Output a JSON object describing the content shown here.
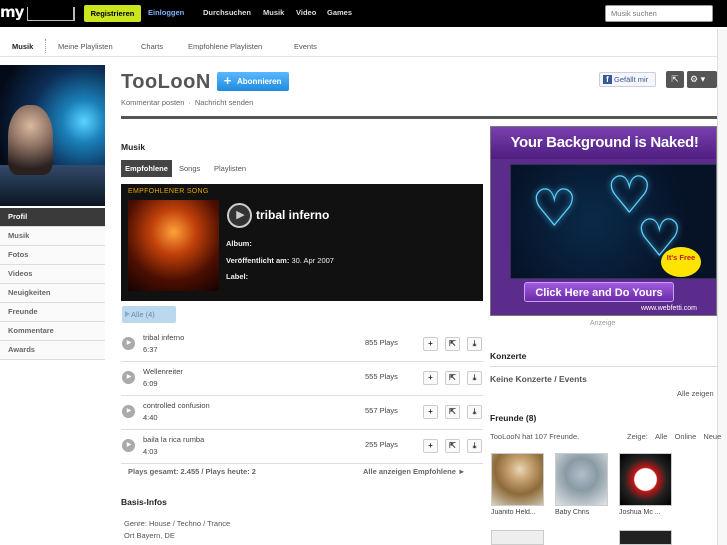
{
  "topbar": {
    "logo": "my",
    "register": "Registrieren",
    "login": "Einloggen",
    "nav": [
      "Durchsuchen",
      "Musik",
      "Video",
      "Games"
    ],
    "search_placeholder": "Musik suchen"
  },
  "subnav": [
    "Musik",
    "Meine Playlisten",
    "Charts",
    "Empfohlene Playlisten",
    "Events"
  ],
  "profile": {
    "name": "TooLooN",
    "subscribe": "Abonnieren",
    "actions": [
      "Kommentar posten",
      "Nachricht senden"
    ],
    "like": "Gefällt mir"
  },
  "leftmenu": [
    "Profil",
    "Musik",
    "Fotos",
    "Videos",
    "Neuigkeiten",
    "Freunde",
    "Kommentare",
    "Awards"
  ],
  "music": {
    "heading": "Musik",
    "tabs": [
      "Empfohlene",
      "Songs",
      "Playlisten"
    ],
    "featured": {
      "label": "EMPFOHLENER SONG",
      "title": "tribal inferno",
      "album_label": "Album:",
      "album": "",
      "released_label": "Veröffentlicht am:",
      "released": "30. Apr 2007",
      "label_label": "Label:",
      "label_value": ""
    },
    "all_button": "Alle (4)",
    "tracks": [
      {
        "name": "tribal inferno",
        "length": "6:37",
        "plays": "855 Plays"
      },
      {
        "name": "Wellenreiter",
        "length": "6:09",
        "plays": "555 Plays"
      },
      {
        "name": "controlled confusion",
        "length": "4:40",
        "plays": "557 Plays"
      },
      {
        "name": "baila la rica rumba",
        "length": "4:03",
        "plays": "255 Plays"
      }
    ],
    "totals": "Plays gesamt: 2.455 / Plays heute: 2",
    "show_all": "Alle anzeigen Empfohlene ►"
  },
  "basis": {
    "heading": "Basis-Infos",
    "genre": "Genre: House / Techno / Trance",
    "ort": "Ort Bayern, DE"
  },
  "ad": {
    "headline": "Your Background is Naked!",
    "badge": "It's Free",
    "cta": "Click Here and Do Yours",
    "url": "www.webfetti.com",
    "label": "Anzeige"
  },
  "konzerte": {
    "heading": "Konzerte",
    "none": "Keine Konzerte / Events",
    "all": "Alle zeigen"
  },
  "freunde": {
    "heading": "Freunde (8)",
    "count_text": "TooLooN hat 107 Freunde.",
    "filter_label": "Zeige:",
    "filters": [
      "Alle",
      "Online",
      "Neue"
    ],
    "friends": [
      "Juanito Held...",
      "Baby Chris",
      "Joshua Mc ..."
    ]
  },
  "colors": {
    "accent": "#cbe51e",
    "subscribe": "#1f8be0",
    "link": "#7fb3ff"
  }
}
